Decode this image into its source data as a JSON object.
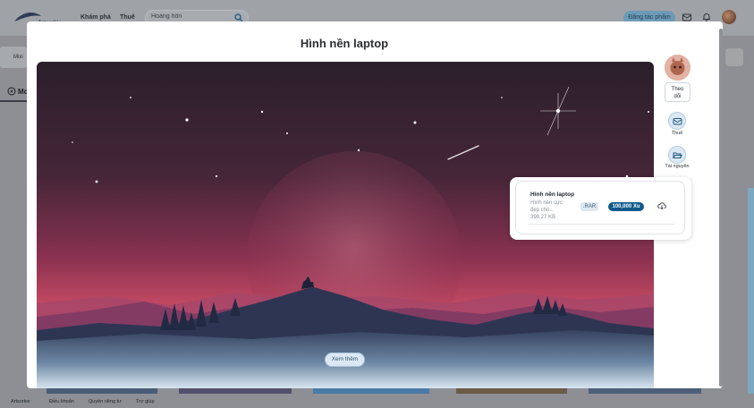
{
  "header": {
    "logo_text": "Artsorkie",
    "nav": [
      "Khám phá",
      "Thuê"
    ],
    "search": {
      "value": "Hoàng hôn"
    },
    "cta_label": "Đăng tác phẩm"
  },
  "background": {
    "strip_label": "Mixi",
    "tab_label": "Mo"
  },
  "footer": {
    "links": [
      "Artsorkie",
      "Điều khoản",
      "Quyền riêng tư",
      "Trợ giúp"
    ]
  },
  "modal": {
    "title": "Hình nền laptop",
    "see_more_label": "Xem thêm",
    "follow_label_line1": "Theo",
    "follow_label_line2": "dõi",
    "hire_label": "Thuê",
    "resources_label": "Tài nguyên"
  },
  "resource": {
    "name": "Hình nền laptop",
    "description_line1": "Hình nền cực",
    "description_line2": "đẹp cho...",
    "size": "398.27 KB",
    "extension": ".RAR",
    "price": "100,000 Xu"
  },
  "colors": {
    "accent": "#0f5a8a",
    "sky_top": "#2b1f2c",
    "sky_horizon": "#d9526a"
  }
}
